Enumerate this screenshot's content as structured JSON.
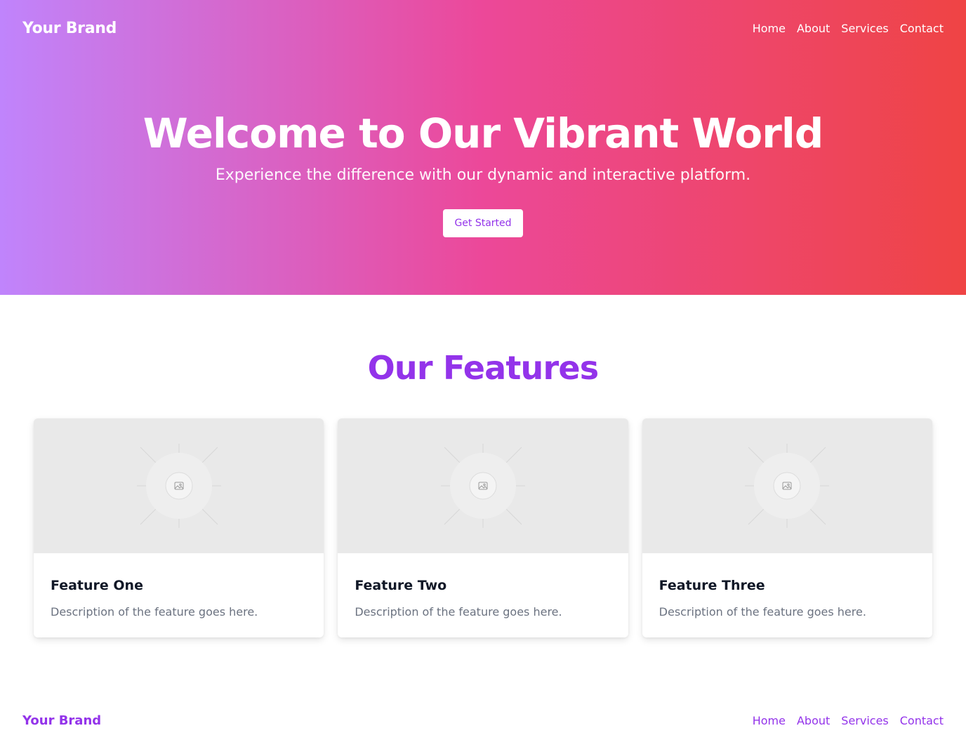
{
  "header": {
    "brand": "Your Brand",
    "nav": [
      "Home",
      "About",
      "Services",
      "Contact"
    ]
  },
  "hero": {
    "title": "Welcome to Our Vibrant World",
    "subtitle": "Experience the difference with our dynamic and interactive platform.",
    "cta_label": "Get Started"
  },
  "features": {
    "title": "Our Features",
    "cards": [
      {
        "title": "Feature One",
        "description": "Description of the feature goes here.",
        "image_icon": "image-placeholder-icon"
      },
      {
        "title": "Feature Two",
        "description": "Description of the feature goes here.",
        "image_icon": "image-placeholder-icon"
      },
      {
        "title": "Feature Three",
        "description": "Description of the feature goes here.",
        "image_icon": "image-placeholder-icon"
      }
    ]
  },
  "footer": {
    "brand": "Your Brand",
    "nav": [
      "Home",
      "About",
      "Services",
      "Contact"
    ]
  },
  "colors": {
    "gradient_start": "#c084fc",
    "gradient_mid": "#ec4899",
    "gradient_end": "#ef4444",
    "accent": "#9333ea"
  }
}
